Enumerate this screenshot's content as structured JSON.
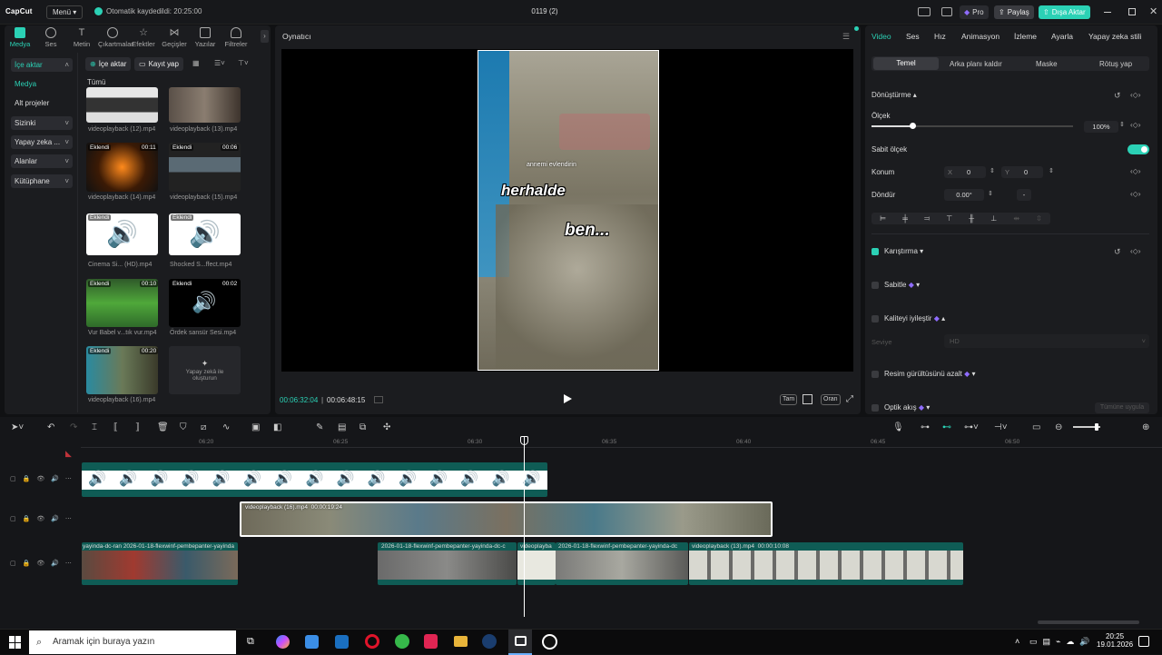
{
  "colors": {
    "accent": "#2bd1b5",
    "bg": "#101113",
    "panel": "#1b1c1f",
    "teal_clip": "#0f5c55",
    "purple": "#8f6cff"
  },
  "topbar": {
    "logo": "CapCut",
    "menu": "Menü",
    "autosave": "Otomatik kaydedildi: 20:25:00",
    "project_title": "0119 (2)",
    "pro": "Pro",
    "share": "Paylaş",
    "export": "Dışa Aktar"
  },
  "media_tabs": [
    {
      "label": "Medya",
      "icon": "import-icon"
    },
    {
      "label": "Ses",
      "icon": "audio-icon"
    },
    {
      "label": "Metin",
      "icon": "text-icon"
    },
    {
      "label": "Çıkartmalar",
      "icon": "sticker-icon"
    },
    {
      "label": "Efektler",
      "icon": "effects-icon"
    },
    {
      "label": "Geçişler",
      "icon": "transition-icon"
    },
    {
      "label": "Yazılar",
      "icon": "captions-icon"
    },
    {
      "label": "Filtreler",
      "icon": "filter-icon"
    }
  ],
  "sidebar": {
    "items": [
      "İçe aktar",
      "Medya",
      "Alt projeler",
      "Sizinki",
      "Yapay zeka ...",
      "Alanlar",
      "Kütüphane"
    ]
  },
  "media_toolbar": {
    "import": "İçe aktar",
    "record": "Kayıt yap",
    "all": "Tümü"
  },
  "media_items": [
    {
      "name": "videoplayback (12).mp4",
      "badge": "",
      "dur": ""
    },
    {
      "name": "videoplayback (13).mp4",
      "badge": "",
      "dur": ""
    },
    {
      "name": "videoplayback (14).mp4",
      "badge": "Eklendi",
      "dur": "00:11"
    },
    {
      "name": "videoplayback (15).mp4",
      "badge": "Eklendi",
      "dur": "00:06"
    },
    {
      "name": "Cinema Si... (HD).mp4",
      "badge": "Eklendi",
      "dur": ""
    },
    {
      "name": "Shocked S...ffect.mp4",
      "badge": "Eklendi",
      "dur": ""
    },
    {
      "name": "Vur Babel v...tık vur.mp4",
      "badge": "Eklendi",
      "dur": "00:10"
    },
    {
      "name": "Ördek sansür Sesi.mp4",
      "badge": "Eklendi",
      "dur": "00:02"
    },
    {
      "name": "videoplayback (16).mp4",
      "badge": "Eklendi",
      "dur": "00:20"
    }
  ],
  "ai_create": {
    "line1": "Yapay zekâ ile",
    "line2": "oluşturun"
  },
  "player": {
    "title": "Oynatıcı",
    "current": "00:06:32:04",
    "total": "00:06:48:15",
    "full": "Tam",
    "ratio": "Oran",
    "sub1": "herhalde",
    "sub2": "ben...",
    "tiny": "annemi evlendirin"
  },
  "inspector": {
    "tabs": [
      "Video",
      "Ses",
      "Hız",
      "Animasyon",
      "İzleme",
      "Ayarla",
      "Yapay zeka stili"
    ],
    "subtabs": [
      "Temel",
      "Arka planı kaldır",
      "Maske",
      "Rötuş yap"
    ],
    "transform": "Dönüştürme",
    "scale": "Ölçek",
    "scale_value": "100%",
    "uniform": "Sabit ölçek",
    "position": "Konum",
    "x_label": "X",
    "x_value": "0",
    "y_label": "Y",
    "y_value": "0",
    "rotate": "Döndür",
    "rotate_value": "0.00°",
    "rotate_dash": "-",
    "blend": "Karıştırma",
    "stabilize": "Sabitle",
    "enhance": "Kaliteyi iyileştir",
    "level": "Seviye",
    "level_value": "HD",
    "denoise": "Resim gürültüsünü azalt",
    "optical": "Optik akış",
    "apply_all": "Tümüne uygula",
    "scale_fraction": 0.52
  },
  "timeline": {
    "ticks": [
      "06:20",
      "06:25",
      "06:30",
      "06:35",
      "06:40",
      "06:45",
      "06:50"
    ],
    "clip_main": "videoplayback (16).mp4",
    "clip_main_dur": "00:00:19:24",
    "clip_a": "yayinda-dc-ran",
    "clip_b": "2026-01-18-flexwinf-pembepanter-yayinda",
    "clip_c": "2026-01-18-flexwinf-pembepanter-yayinda-dc-c",
    "clip_d": "videoplayba",
    "clip_e": "2026-01-18-flexwinf-pembepanter-yayinda-dc",
    "clip_f": "videoplayback (13).mp4",
    "clip_f_dur": "00:00:10:08"
  },
  "taskbar": {
    "search": "Aramak için buraya yazın",
    "time": "20:25",
    "date": "19.01.2026"
  }
}
